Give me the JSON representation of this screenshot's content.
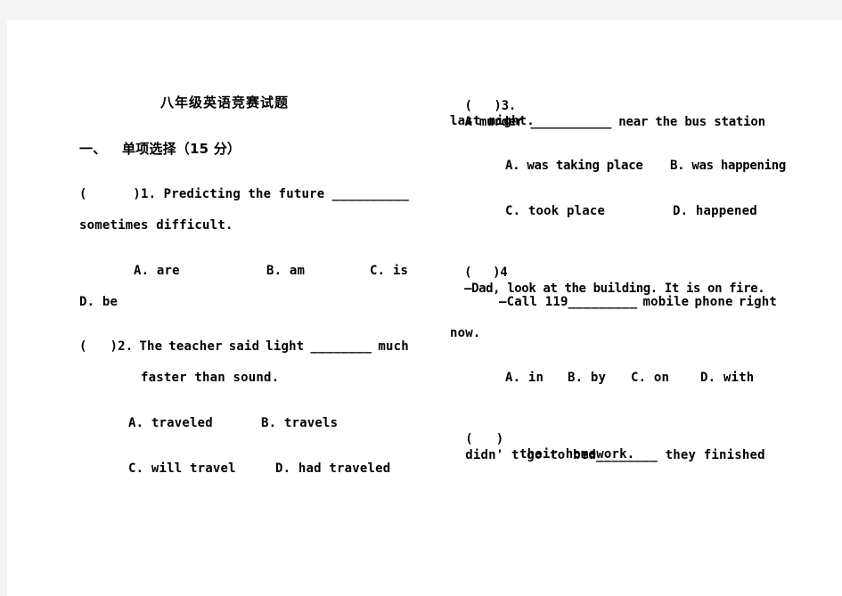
{
  "document": {
    "title": "八年级英语竞赛试题",
    "section": {
      "number": "一、",
      "heading": "单项选择（15 分）"
    },
    "questions": [
      {
        "id": "q1",
        "line1": {
          "bracket": "(      )1.",
          "words": [
            "Predicting",
            "the",
            "future",
            "__________"
          ]
        },
        "line2": "sometimes difficult.",
        "options_line1": [
          "A. are",
          "B. am",
          "C. is"
        ],
        "options_line2": [
          "D. be"
        ]
      },
      {
        "id": "q2",
        "line1": {
          "bracket": "(   )2.",
          "words": [
            "The",
            "teacher",
            "said",
            "light",
            "________",
            "much"
          ]
        },
        "line2": "faster than sound.",
        "options_line1": [
          "A. traveled",
          "B. travels"
        ],
        "options_line2": [
          "C. will travel",
          "D. had traveled"
        ]
      },
      {
        "id": "q3",
        "line1": {
          "bracket": "(   )3.",
          "text": "A murder ___________ near the bus station"
        },
        "line2": "last night.",
        "options_line1": [
          "A. was taking place",
          "B. was happening"
        ],
        "options_line2": [
          "C. took place",
          "D. happened"
        ]
      },
      {
        "id": "q4",
        "line1": {
          "bracket": "(   )4",
          "text": "—Dad, look at the building. It is on fire."
        },
        "line2": {
          "text": "—Call 119_________",
          "words": [
            "mobile",
            "phone",
            "right"
          ]
        },
        "line3": "now.",
        "options_line1": [
          "A. in",
          "B. by",
          "C. on",
          "D. with"
        ]
      },
      {
        "id": "q5",
        "line1": {
          "bracket": "(   )",
          "text": "didn' t go to bed________ they finished"
        },
        "line2": "their homework."
      }
    ]
  }
}
